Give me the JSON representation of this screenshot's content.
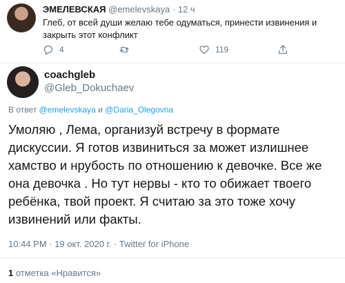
{
  "reply_tweet": {
    "name": "ЭМЕЛЕВСКАЯ",
    "handle": "@emelevskaya",
    "separator": "·",
    "time": "12 ч",
    "text": "Глеб, от всей души желаю тебе одуматься, принести извинения и закрыть этот конфликт",
    "reply_count": "4",
    "like_count": "119"
  },
  "main_tweet": {
    "name": "coachgleb",
    "handle": "@Gleb_Dokuchaev",
    "reply_prefix": "В ответ",
    "reply_user_1": "@emelevskaya",
    "reply_and": "и",
    "reply_user_2": "@Daria_Olegovna",
    "text": "Умоляю , Лема, организуй встречу в формате дискуссии. Я готов извиниться за может излишнее хамство и нрубость по отношению к девочке. Все же она девочка . Но тут нервы - кто то обижает твоего ребёнка, твой проект. Я считаю за  это тоже хочу извинений или факты.",
    "meta": "10:44 PM · 19 окт. 2020 г. · Twitter for iPhone",
    "likes_count": "1",
    "likes_label": "отметка «Нравится»"
  },
  "colors": {
    "accent": "#1da1f2",
    "muted": "#657786",
    "text": "#14171a",
    "divider": "#e6ecf0"
  }
}
